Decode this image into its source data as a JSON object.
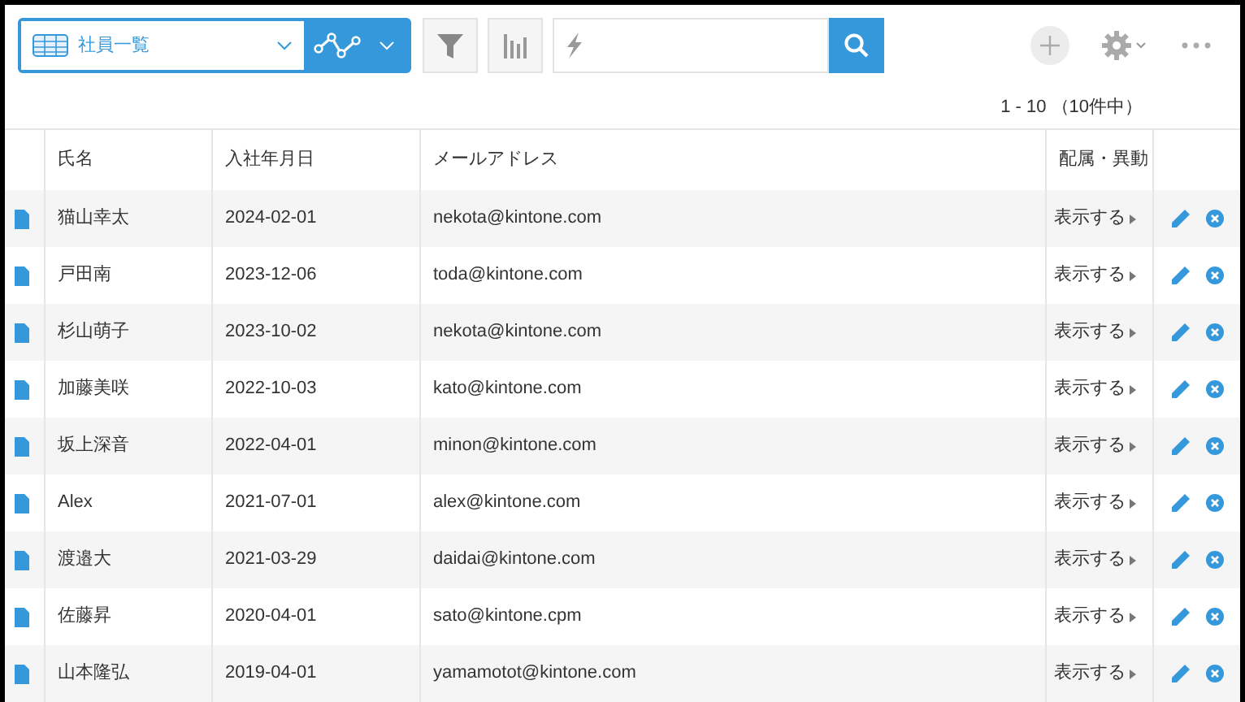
{
  "toolbar": {
    "view_name": "社員一覧"
  },
  "pagination": "1 - 10 （10件中）",
  "table": {
    "columns": [
      "氏名",
      "入社年月日",
      "メールアドレス",
      "配属・異動"
    ],
    "rows": [
      {
        "name": "猫山幸太",
        "date": "2024-02-01",
        "email": "nekota@kintone.com",
        "link": "表示する"
      },
      {
        "name": "戸田南",
        "date": "2023-12-06",
        "email": "toda@kintone.com",
        "link": "表示する"
      },
      {
        "name": "杉山萌子",
        "date": "2023-10-02",
        "email": "nekota@kintone.com",
        "link": "表示する"
      },
      {
        "name": "加藤美咲",
        "date": "2022-10-03",
        "email": "kato@kintone.com",
        "link": "表示する"
      },
      {
        "name": "坂上深音",
        "date": "2022-04-01",
        "email": "minon@kintone.com",
        "link": "表示する"
      },
      {
        "name": "Alex",
        "date": "2021-07-01",
        "email": "alex@kintone.com",
        "link": "表示する"
      },
      {
        "name": "渡邉大",
        "date": "2021-03-29",
        "email": "daidai@kintone.com",
        "link": "表示する"
      },
      {
        "name": "佐藤昇",
        "date": "2020-04-01",
        "email": "sato@kintone.cpm",
        "link": "表示する"
      },
      {
        "name": "山本隆弘",
        "date": "2019-04-01",
        "email": "yamamotot@kintone.com",
        "link": "表示する"
      }
    ]
  }
}
